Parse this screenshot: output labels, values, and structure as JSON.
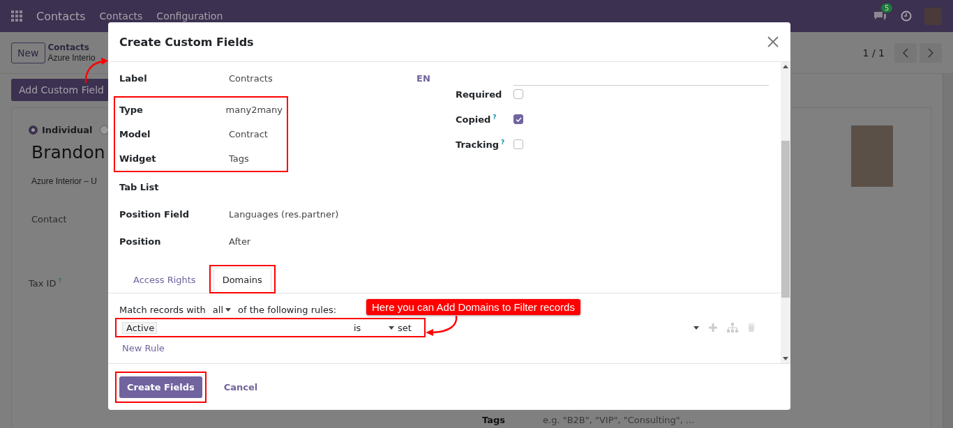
{
  "navbar": {
    "app_name": "Contacts",
    "menu": [
      "Contacts",
      "Configuration"
    ],
    "message_count": "5"
  },
  "control_panel": {
    "new_button": "New",
    "breadcrumb": [
      "Contacts",
      "Azure Interio"
    ],
    "pager": "1 / 1"
  },
  "toolbar": {
    "add_button": "Add Custom Field"
  },
  "form": {
    "company_types": [
      {
        "label": "Individual",
        "selected": true
      },
      {
        "selected": false
      }
    ],
    "name": "Brandon",
    "company": "Azure Interior – U",
    "fields": [
      {
        "label": "Contact"
      },
      {
        "label": "Tax ID",
        "hint_mark": "?"
      }
    ],
    "tags": {
      "label": "Tags",
      "placeholder": "e.g. \"B2B\", \"VIP\", \"Consulting\", ..."
    }
  },
  "dialog": {
    "title": "Create Custom Fields",
    "fields": [
      {
        "label": "Label",
        "value": "Contracts",
        "highlighted": false
      },
      {
        "label": "Type",
        "value": "many2many",
        "highlighted": true
      },
      {
        "label": "Model",
        "value": "Contract",
        "highlighted": true
      },
      {
        "label": "Widget",
        "value": "Tags",
        "highlighted": true
      },
      {
        "label": "Tab List",
        "highlighted": false
      },
      {
        "label": "Position Field",
        "value": "Languages (res.partner)",
        "highlighted": false
      },
      {
        "label": "Position",
        "value": "After",
        "highlighted": false
      }
    ],
    "language": "EN",
    "options": [
      {
        "label": "Required",
        "checked": false
      },
      {
        "label": "Copied",
        "hint_mark": "?",
        "checked": true
      },
      {
        "label": "Tracking",
        "hint_mark": "?",
        "checked": false
      }
    ],
    "tabs": [
      {
        "label": "Access Rights",
        "selected": false,
        "highlighted": false
      },
      {
        "label": "Domains",
        "selected": true,
        "highlighted": true
      }
    ],
    "domain": {
      "prefix": "Match records with",
      "quantifier": "all",
      "suffix": "of the following rules:",
      "rules": [
        {
          "field": "Active",
          "operator": "is",
          "value": "set",
          "highlighted": true
        }
      ],
      "new_rule": "New Rule"
    },
    "buttons": [
      {
        "label": "Create Fields",
        "kind": "primary",
        "highlighted": true
      },
      {
        "label": "Cancel",
        "kind": "link",
        "highlighted": false
      }
    ]
  },
  "annotation": {
    "callout": "Here you can Add Domains to Filter records"
  }
}
